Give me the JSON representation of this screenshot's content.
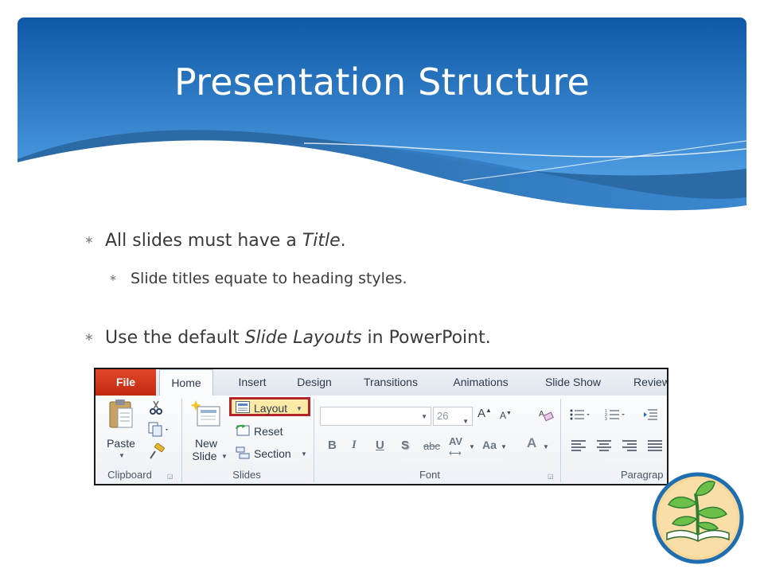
{
  "slide": {
    "title": "Presentation Structure"
  },
  "bullets": [
    {
      "pre": "All slides must have a ",
      "em": "Title",
      "post": "."
    },
    {
      "text": "Slide titles equate to heading styles."
    },
    {
      "pre": "Use the default ",
      "em": "Slide Layouts",
      "post": " in PowerPoint."
    }
  ],
  "bullet_glyph": "∗",
  "ribbon": {
    "tabs": [
      "File",
      "Home",
      "Insert",
      "Design",
      "Transitions",
      "Animations",
      "Slide Show",
      "Review"
    ],
    "clipboard": {
      "paste": "Paste",
      "group": "Clipboard"
    },
    "slides": {
      "new_slide_1": "New",
      "new_slide_2": "Slide",
      "layout": "Layout",
      "reset": "Reset",
      "section": "Section",
      "group": "Slides"
    },
    "font": {
      "size": "26",
      "bold": "B",
      "italic": "I",
      "underline": "U",
      "shadow": "S",
      "strike": "abc",
      "spacing": "AV",
      "case": "Aa",
      "color": "A",
      "group": "Font"
    },
    "paragraph": {
      "group": "Paragrap"
    }
  },
  "colors": {
    "banner_top": "#0f5aa8",
    "banner_bottom": "#5aa9ef",
    "highlight_border": "#b32428",
    "file_tab": "#d4381c"
  }
}
